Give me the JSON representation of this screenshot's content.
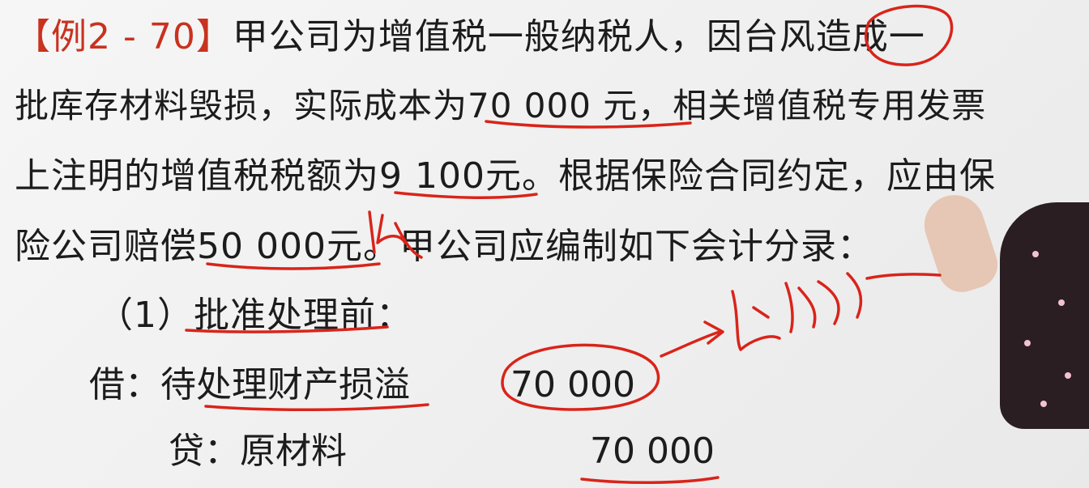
{
  "slide": {
    "example_tag": "【例2 - 70】",
    "paragraph_lines": [
      "甲公司为增值税一般纳税人，因台风造成一",
      "批库存材料毁损，实际成本为70 000 元，相关增值税专用发票",
      "上注明的增值税税额为9 100元。根据保险合同约定，应由保",
      "险公司赔偿50 000元。甲公司应编制如下会计分录："
    ],
    "step_title": "（1）批准处理前：",
    "entry": {
      "debit_label": "借：待处理财产损溢",
      "debit_amount": "70 000",
      "credit_label": "贷：原材料",
      "credit_amount": "70 000"
    }
  },
  "colors": {
    "text": "#1c1c1c",
    "tag": "#c8321f",
    "ink": "#d9241a",
    "background": "#f2f2f2"
  }
}
